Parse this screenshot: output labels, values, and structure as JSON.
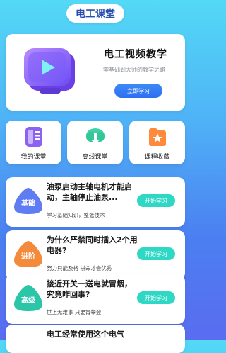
{
  "header": {
    "title": "电工课堂"
  },
  "hero": {
    "title": "电工视频教学",
    "subtitle": "零基础到大师的教学之路",
    "button": "立即学习"
  },
  "quick": [
    {
      "label": "我的课堂",
      "icon": "book-icon"
    },
    {
      "label": "离线课堂",
      "icon": "cloud-download-icon"
    },
    {
      "label": "课程收藏",
      "icon": "star-folder-icon"
    }
  ],
  "courses": [
    {
      "badge": "基础",
      "title": "油泵启动主轴电机才能启动，主轴停止油泵...",
      "subtitle": "学习基础知识，整张技术",
      "button": "开始学习",
      "color": "#5f7cf2"
    },
    {
      "badge": "进阶",
      "title": "为什么严禁同时插入2个用电器?",
      "subtitle": "努力只能及格 拼命才会优秀",
      "button": "开始学习",
      "color": "#f48a3c"
    },
    {
      "badge": "高级",
      "title": "接近开关一送电就冒烟，究竟咋回事?",
      "subtitle": "世上无难事 只要肯攀登",
      "button": "开始学习",
      "color": "#2bc6a8"
    },
    {
      "badge": "",
      "title": "电工经常使用这个电气",
      "subtitle": "",
      "button": "",
      "color": "#5f7cf2"
    }
  ],
  "colors": {
    "accent": "#2f6ef2",
    "start_button": "#2ed8c4"
  }
}
